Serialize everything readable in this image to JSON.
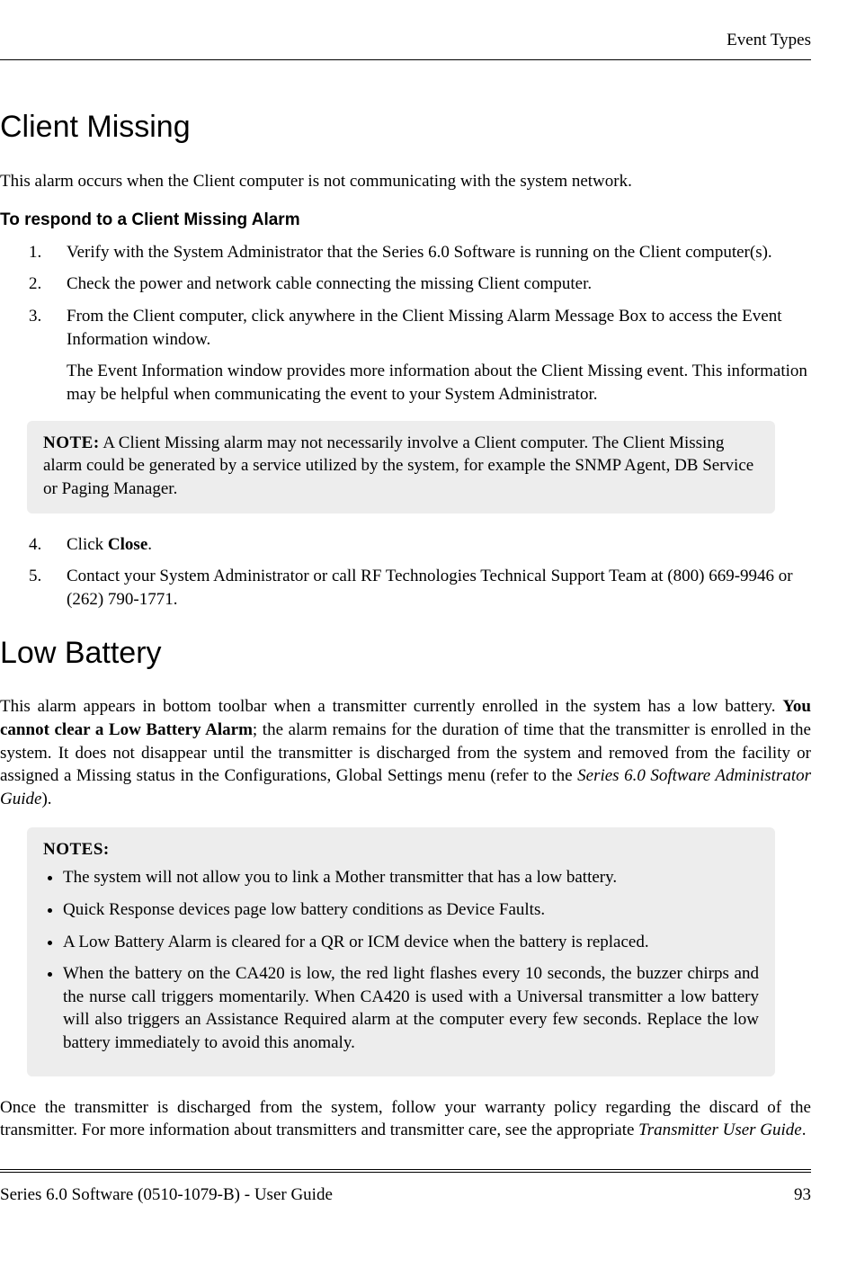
{
  "runningHead": "Event Types",
  "section1": {
    "title": "Client Missing",
    "intro": "This alarm occurs when the Client computer is not communicating with the system network.",
    "procTitle": "To respond to a Client Missing Alarm",
    "stepsA": [
      {
        "n": "1.",
        "text": "Verify with the System Administrator that the Series 6.0 Software is running on the Client computer(s)."
      },
      {
        "n": "2.",
        "text": "Check the power and network cable connecting the missing Client computer."
      },
      {
        "n": "3.",
        "text": "From the Client computer, click anywhere in the Client Missing Alarm Message Box to access the Event Information window.",
        "sub": "The Event Information window provides more information about the Client Missing event. This information may be helpful when communicating the event to your System Administrator."
      }
    ],
    "note": {
      "label": "NOTE:",
      "body": " A Client Missing alarm may not necessarily involve a Client computer. The Client Missing alarm could be generated by a service utilized by the system, for example the SNMP Agent, DB Service or Paging Manager."
    },
    "stepsB": [
      {
        "n": "4.",
        "pre": "Click ",
        "bold": "Close",
        "post": "."
      },
      {
        "n": "5.",
        "text": "Contact your System Administrator or call RF Technologies Technical Support Team at (800) 669-9946 or (262) 790-1771."
      }
    ]
  },
  "section2": {
    "title": "Low Battery",
    "intro": {
      "pre": "This alarm appears in bottom toolbar when a transmitter currently enrolled in the system has a low battery. ",
      "bold": "You cannot clear a Low Battery Alarm",
      "mid": "; the alarm remains for the duration of time that the transmitter is enrolled in the system. It does not disappear until the transmitter is discharged from the system and removed from the facility or assigned a Missing status in the Configurations, Global Settings menu (refer to the ",
      "ital": "Series 6.0 Software Administrator Guide",
      "post": ")."
    },
    "notesLabel": "NOTES:",
    "notes": [
      "The system will not allow you to link a Mother transmitter that has a low battery.",
      "Quick Response devices page low battery conditions as Device Faults.",
      "A Low Battery Alarm is cleared for a QR or ICM device when the battery is replaced.",
      "When the battery on the CA420 is low, the red light flashes every 10 seconds, the buzzer chirps and the nurse call triggers momentarily. When CA420 is used with a Universal transmitter a low battery will also triggers an Assistance Required alarm at the computer every few seconds. Replace the low battery immediately to avoid this anomaly."
    ],
    "closing": {
      "pre": "Once the transmitter is discharged from the system, follow your warranty policy regarding the discard of the transmitter. For more information about transmitters and transmitter care, see the appropriate ",
      "ital": "Transmitter User Guide",
      "post": "."
    }
  },
  "footer": {
    "left": "Series 6.0 Software (0510-1079-B) - User Guide",
    "right": "93"
  }
}
